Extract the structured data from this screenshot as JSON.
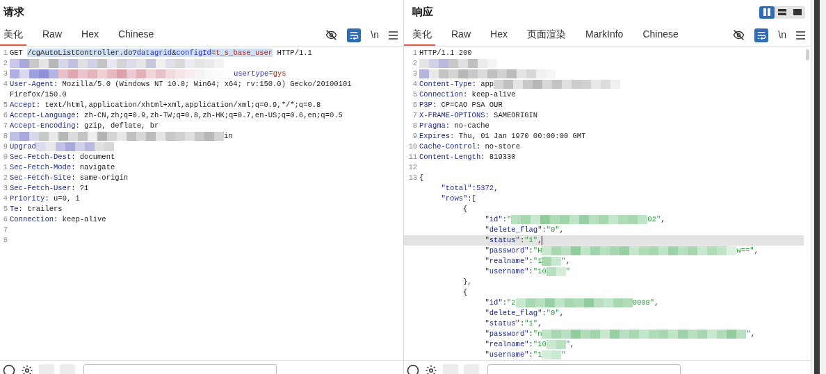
{
  "panes": [
    {
      "title": "请求",
      "tabs": [
        {
          "label": "美化",
          "selected": true
        },
        {
          "label": "Raw",
          "selected": false
        },
        {
          "label": "Hex",
          "selected": false
        },
        {
          "label": "Chinese",
          "selected": false
        }
      ],
      "toolbar": {
        "wrap_on": true,
        "newline_label": "\\n"
      },
      "lines": [
        {
          "num": "1",
          "segments": [
            {
              "kind": "plain",
              "text": "GET ",
              "selected": false
            },
            {
              "kind": "plain",
              "text": "/cgAutoListController.do?",
              "selected": true
            },
            {
              "kind": "param",
              "text": "datagrid",
              "selected": true
            },
            {
              "kind": "plain",
              "text": "&",
              "selected": true
            },
            {
              "kind": "param",
              "text": "configId",
              "selected": true
            },
            {
              "kind": "plain",
              "text": "=",
              "selected": true
            },
            {
              "kind": "pval",
              "text": "t_s_base_user",
              "selected": true
            },
            {
              "kind": "plain",
              "text": " HTTP/1.1",
              "selected": false
            }
          ]
        },
        {
          "num": "2",
          "segments": [
            {
              "kind": "redacted",
              "cells": [
                {
                  "color": "#c8c8e8"
                },
                {
                  "color": "#a8a8dc"
                },
                {
                  "color": "#c8c8c8"
                },
                {
                  "color": "#e4e4e4"
                },
                {
                  "color": "#b8b8b8"
                },
                {
                  "color": "#d8d8ec"
                },
                {
                  "color": "#c0c0e0"
                },
                {
                  "color": "#e0e0e0"
                },
                {
                  "color": "#d0d0e8"
                },
                {
                  "color": "#c4c4c4"
                },
                {
                  "color": "#e8e8f0"
                },
                {
                  "color": "#d4d4d4"
                },
                {
                  "color": "#dcdcec"
                },
                {
                  "color": "#e6e6e6"
                },
                {
                  "color": "#c8c8dc"
                },
                {
                  "color": "#f0f0f0"
                },
                {
                  "color": "#e0e0ec"
                },
                {
                  "color": "#dadada"
                },
                {
                  "color": "#ececf4"
                },
                {
                  "color": "#e4e4e4"
                },
                {
                  "color": "#eaeaea"
                },
                {
                  "color": "#f2f2f2"
                }
              ]
            }
          ]
        },
        {
          "num": "3",
          "segments": [
            {
              "kind": "redacted",
              "cells": [
                {
                  "color": "#b0b0e0"
                },
                {
                  "color": "#d8d8ee"
                },
                {
                  "color": "#a0a0dc"
                },
                {
                  "color": "#9090d8"
                },
                {
                  "color": "#b4b4e4"
                },
                {
                  "color": "#e8c0c8"
                },
                {
                  "color": "#e0a8b0"
                },
                {
                  "color": "#ecc4cc"
                },
                {
                  "color": "#e4b4bc"
                },
                {
                  "color": "#f0d0d4"
                },
                {
                  "color": "#e8b8c0"
                },
                {
                  "color": "#dca0a8"
                },
                {
                  "color": "#ecc8d0"
                },
                {
                  "color": "#e4b0b8"
                },
                {
                  "color": "#f0d4d8"
                },
                {
                  "color": "#e8c0c8"
                },
                {
                  "color": "#f2dadc"
                },
                {
                  "color": "#f6e4e6"
                },
                {
                  "color": "#f8ecee"
                },
                {
                  "color": "#f4f4f4"
                },
                {
                  "color": "#fafafa"
                },
                {
                  "color": "#fcfcfc"
                },
                {
                  "color": "#fefefe"
                }
              ]
            },
            {
              "kind": "param",
              "text": "usertype",
              "selected": false
            },
            {
              "kind": "plain",
              "text": "=",
              "selected": false
            },
            {
              "kind": "pval",
              "text": "gys",
              "selected": false
            }
          ]
        },
        {
          "num": "4",
          "segments": [
            {
              "kind": "name",
              "text": "User-Agent"
            },
            {
              "kind": "plain",
              "text": ": Mozilla/5.0 (Windows NT 10.0; Win64; x64; rv:150.0) Gecko/20100101",
              "selected": false
            }
          ]
        },
        {
          "segments": [
            {
              "kind": "plain",
              "text": "Firefox/150.0",
              "selected": false
            }
          ]
        },
        {
          "num": "5",
          "segments": [
            {
              "kind": "name",
              "text": "Accept"
            },
            {
              "kind": "plain",
              "text": ": text/html,application/xhtml+xml,application/xml;q=0.9,*/*;q=0.8",
              "selected": false
            }
          ]
        },
        {
          "num": "6",
          "segments": [
            {
              "kind": "name",
              "text": "Accept-Language"
            },
            {
              "kind": "plain",
              "text": ": zh-CN,zh;q=0.9,zh-TW;q=0.8,zh-HK;q=0.7,en-US;q=0.6,en;q=0.5",
              "selected": false
            }
          ]
        },
        {
          "num": "7",
          "segments": [
            {
              "kind": "name",
              "text": "Accept-Encoding"
            },
            {
              "kind": "plain",
              "text": ": gzip, deflate, br",
              "selected": false
            }
          ]
        },
        {
          "num": "8",
          "segments": [
            {
              "kind": "redacted",
              "cells": [
                {
                  "color": "#c0c0e4"
                },
                {
                  "color": "#a8a8dc"
                },
                {
                  "color": "#d8d8ec"
                },
                {
                  "color": "#c8c8c8"
                },
                {
                  "color": "#e8e8e8"
                },
                {
                  "color": "#b8b8b8"
                },
                {
                  "color": "#dcdcdc"
                },
                {
                  "color": "#c4c4c4"
                },
                {
                  "color": "#eeeeee"
                },
                {
                  "color": "#b4b4b4"
                },
                {
                  "color": "#d4d4d4"
                },
                {
                  "color": "#e8e8e8"
                },
                {
                  "color": "#c0c0c0"
                },
                {
                  "color": "#d8d8d8"
                },
                {
                  "color": "#bcbcbc"
                },
                {
                  "color": "#e4e4e4"
                },
                {
                  "color": "#c8c8c8"
                },
                {
                  "color": "#d0d0d0"
                },
                {
                  "color": "#e0e0e0"
                },
                {
                  "color": "#c8c8c8"
                },
                {
                  "color": "#b8b8b8"
                },
                {
                  "color": "#d4d4d4"
                }
              ]
            },
            {
              "kind": "plain",
              "text": "in",
              "selected": false
            }
          ]
        },
        {
          "num": "9",
          "segments": [
            {
              "kind": "name",
              "text": "Upgrad"
            },
            {
              "kind": "redacted",
              "cells": [
                {
                  "color": "#dcdcf0"
                },
                {
                  "color": "#e8e8e8"
                },
                {
                  "color": "#c0c0e4"
                },
                {
                  "color": "#a8a8dc"
                },
                {
                  "color": "#d0d0ec"
                },
                {
                  "color": "#b8b8e0"
                },
                {
                  "color": "#e0e0e0"
                },
                {
                  "color": "#d8d8d8"
                }
              ]
            }
          ]
        },
        {
          "num": "0",
          "segments": [
            {
              "kind": "name",
              "text": "Sec-Fetch-Dest"
            },
            {
              "kind": "plain",
              "text": ": document",
              "selected": false
            }
          ]
        },
        {
          "num": "1",
          "segments": [
            {
              "kind": "name",
              "text": "Sec-Fetch-Mode"
            },
            {
              "kind": "plain",
              "text": ": navigate",
              "selected": false
            }
          ]
        },
        {
          "num": "2",
          "segments": [
            {
              "kind": "name",
              "text": "Sec-Fetch-Site"
            },
            {
              "kind": "plain",
              "text": ": same-origin",
              "selected": false
            }
          ]
        },
        {
          "num": "3",
          "segments": [
            {
              "kind": "name",
              "text": "Sec-Fetch-User"
            },
            {
              "kind": "plain",
              "text": ": ?1",
              "selected": false
            }
          ]
        },
        {
          "num": "4",
          "segments": [
            {
              "kind": "name",
              "text": "Priority"
            },
            {
              "kind": "plain",
              "text": ": u=0, i",
              "selected": false
            }
          ]
        },
        {
          "num": "5",
          "segments": [
            {
              "kind": "name",
              "text": "Te"
            },
            {
              "kind": "plain",
              "text": ": trailers",
              "selected": false
            }
          ]
        },
        {
          "num": "6",
          "segments": [
            {
              "kind": "name",
              "text": "Connection"
            },
            {
              "kind": "plain",
              "text": ": keep-alive",
              "selected": false
            }
          ]
        },
        {
          "num": "7"
        },
        {
          "num": "8"
        }
      ]
    },
    {
      "title": "响应",
      "tabs": [
        {
          "label": "美化",
          "selected": true
        },
        {
          "label": "Raw",
          "selected": false
        },
        {
          "label": "Hex",
          "selected": false
        },
        {
          "label": "页面渲染",
          "selected": false
        },
        {
          "label": "MarkInfo",
          "selected": false
        },
        {
          "label": "Chinese",
          "selected": false
        }
      ],
      "layout_modes": [
        {
          "kind": "split",
          "selected": true
        },
        {
          "kind": "stacked",
          "selected": false
        },
        {
          "kind": "single",
          "selected": false
        }
      ],
      "toolbar": {
        "wrap_on": true,
        "newline_label": "\\n"
      },
      "lines": [
        {
          "num": "1",
          "current": false,
          "segments": [
            {
              "kind": "plain",
              "text": "HTTP/1.1 200",
              "selected": false
            }
          ]
        },
        {
          "num": "2",
          "current": false,
          "segments": [
            {
              "kind": "redacted",
              "cells": [
                {
                  "color": "#e4e4e4"
                },
                {
                  "color": "#d0d0e8"
                },
                {
                  "color": "#b8b8e0"
                },
                {
                  "color": "#c8c8c8"
                },
                {
                  "color": "#e0e0e0"
                },
                {
                  "color": "#c0c0c0"
                },
                {
                  "color": "#ececec"
                },
                {
                  "color": "#f4f4f4"
                }
              ]
            }
          ]
        },
        {
          "num": "3",
          "current": false,
          "segments": [
            {
              "kind": "redacted",
              "cells": [
                {
                  "color": "#b4b4dc"
                },
                {
                  "color": "#e8e8e8"
                },
                {
                  "color": "#c4c4c4"
                },
                {
                  "color": "#d4d4d4"
                },
                {
                  "color": "#b8b8b8"
                },
                {
                  "color": "#c8c8c8"
                },
                {
                  "color": "#dcdcdc"
                },
                {
                  "color": "#c0c0c0"
                },
                {
                  "color": "#d0d0d0"
                },
                {
                  "color": "#bcbcbc"
                },
                {
                  "color": "#e4e4e4"
                },
                {
                  "color": "#d8d8d8"
                },
                {
                  "color": "#f0f0f0"
                },
                {
                  "color": "#f6f6f6"
                }
              ]
            }
          ]
        },
        {
          "num": "4",
          "current": false,
          "segments": [
            {
              "kind": "name",
              "text": "Content-Type"
            },
            {
              "kind": "plain",
              "text": ": app",
              "selected": false
            },
            {
              "kind": "redacted",
              "cells": [
                {
                  "color": "#d4d4d4"
                },
                {
                  "color": "#c0c0c0"
                },
                {
                  "color": "#e4e4e4"
                },
                {
                  "color": "#c8c8c8"
                },
                {
                  "color": "#b8b8b8"
                },
                {
                  "color": "#d8d8d8"
                },
                {
                  "color": "#c4c4c4"
                },
                {
                  "color": "#e0e0e0"
                },
                {
                  "color": "#cccccc"
                },
                {
                  "color": "#d0d0d0"
                },
                {
                  "color": "#e8e8e8"
                },
                {
                  "color": "#dcdcdc"
                },
                {
                  "color": "#f0f0f0"
                }
              ]
            }
          ]
        },
        {
          "num": "5",
          "current": false,
          "segments": [
            {
              "kind": "name",
              "text": "Connection"
            },
            {
              "kind": "plain",
              "text": ": keep-alive",
              "selected": false
            }
          ]
        },
        {
          "num": "6",
          "current": false,
          "segments": [
            {
              "kind": "name",
              "text": "P3P"
            },
            {
              "kind": "plain",
              "text": ": CP=CAO PSA OUR",
              "selected": false
            }
          ]
        },
        {
          "num": "7",
          "current": false,
          "segments": [
            {
              "kind": "name",
              "text": "X-FRAME-OPTIONS"
            },
            {
              "kind": "plain",
              "text": ": SAMEORIGIN",
              "selected": false
            }
          ]
        },
        {
          "num": "8",
          "current": false,
          "segments": [
            {
              "kind": "name",
              "text": "Pragma"
            },
            {
              "kind": "plain",
              "text": ": no-cache",
              "selected": false
            }
          ]
        },
        {
          "num": "9",
          "current": false,
          "segments": [
            {
              "kind": "name",
              "text": "Expires"
            },
            {
              "kind": "plain",
              "text": ": Thu, 01 Jan 1970 00:00:00 GMT",
              "selected": false
            }
          ]
        },
        {
          "num": "10",
          "current": false,
          "segments": [
            {
              "kind": "name",
              "text": "Cache-Control"
            },
            {
              "kind": "plain",
              "text": ": no-store",
              "selected": false
            }
          ]
        },
        {
          "num": "11",
          "current": false,
          "segments": [
            {
              "kind": "name",
              "text": "Content-Length"
            },
            {
              "kind": "plain",
              "text": ": 819330",
              "selected": false
            }
          ]
        },
        {
          "num": "12",
          "current": false
        },
        {
          "num": "13",
          "current": false,
          "segments": [
            {
              "kind": "plain",
              "text": "{",
              "selected": false
            }
          ]
        },
        {
          "current": false,
          "segments": [
            {
              "kind": "jkey",
              "text": "     \"total\""
            },
            {
              "kind": "plain",
              "text": ":",
              "selected": false
            },
            {
              "kind": "jnum",
              "text": "5372"
            },
            {
              "kind": "plain",
              "text": ",",
              "selected": false
            }
          ]
        },
        {
          "current": false,
          "segments": [
            {
              "kind": "jkey",
              "text": "     \"rows\""
            },
            {
              "kind": "plain",
              "text": ":[",
              "selected": false
            }
          ]
        },
        {
          "current": false,
          "segments": [
            {
              "kind": "plain",
              "text": "          {",
              "selected": false
            }
          ]
        },
        {
          "current": false,
          "segments": [
            {
              "kind": "jkey",
              "text": "               \"id\""
            },
            {
              "kind": "plain",
              "text": ":",
              "selected": false
            },
            {
              "kind": "jstr",
              "text": "\""
            },
            {
              "kind": "redacted",
              "cells": [
                {
                  "color": "#b8e0c0"
                },
                {
                  "color": "#a8d8b0"
                },
                {
                  "color": "#c8e8d0"
                },
                {
                  "color": "#90cc9c"
                },
                {
                  "color": "#b0dcb8"
                },
                {
                  "color": "#a0d4ac"
                },
                {
                  "color": "#c0e4c8"
                },
                {
                  "color": "#98d0a4"
                },
                {
                  "color": "#b8e0c0"
                },
                {
                  "color": "#a8d8b0"
                },
                {
                  "color": "#c4e6cc"
                },
                {
                  "color": "#b0dcb8"
                },
                {
                  "color": "#a8d8b0"
                },
                {
                  "color": "#c0e4c8"
                }
              ]
            },
            {
              "kind": "jstr",
              "text": "02\""
            },
            {
              "kind": "plain",
              "text": ",",
              "selected": false
            }
          ]
        },
        {
          "current": false,
          "segments": [
            {
              "kind": "jkey",
              "text": "               \"delete_flag\""
            },
            {
              "kind": "plain",
              "text": ":",
              "selected": false
            },
            {
              "kind": "jstr",
              "text": "\"0\""
            },
            {
              "kind": "plain",
              "text": ",",
              "selected": false
            }
          ]
        },
        {
          "current": true,
          "segments": [
            {
              "kind": "jkey",
              "text": "               \"status\""
            },
            {
              "kind": "plain",
              "text": ":",
              "selected": false
            },
            {
              "kind": "jstr",
              "text": "\"1\""
            },
            {
              "kind": "plain",
              "text": ",",
              "selected": false
            }
          ]
        },
        {
          "current": false,
          "segments": [
            {
              "kind": "jkey",
              "text": "               \"password\""
            },
            {
              "kind": "plain",
              "text": ":",
              "selected": false
            },
            {
              "kind": "jstr",
              "text": "\"H"
            },
            {
              "kind": "redacted",
              "cells": [
                {
                  "color": "#c8e8d0"
                },
                {
                  "color": "#a8d8b0"
                },
                {
                  "color": "#b8e0c0"
                },
                {
                  "color": "#90cc9c"
                },
                {
                  "color": "#c0e4c8"
                },
                {
                  "color": "#a0d4ac"
                },
                {
                  "color": "#b8e0c0"
                },
                {
                  "color": "#a8d8b0"
                },
                {
                  "color": "#98d0a4"
                },
                {
                  "color": "#c4e6cc"
                },
                {
                  "color": "#b0dcb8"
                },
                {
                  "color": "#a8d8b0"
                },
                {
                  "color": "#c0e4c8"
                },
                {
                  "color": "#9cd2a8"
                },
                {
                  "color": "#b8e0c0"
                },
                {
                  "color": "#a8d8b0"
                },
                {
                  "color": "#c8e8d0"
                },
                {
                  "color": "#b0dcb8"
                },
                {
                  "color": "#c0e4c8"
                },
                {
                  "color": "#dcf0e0"
                }
              ]
            },
            {
              "kind": "jstr",
              "text": "w==\""
            },
            {
              "kind": "plain",
              "text": ",",
              "selected": false
            }
          ]
        },
        {
          "current": false,
          "segments": [
            {
              "kind": "jkey",
              "text": "               \"realname\""
            },
            {
              "kind": "plain",
              "text": ":",
              "selected": false
            },
            {
              "kind": "jstr",
              "text": "\"1"
            },
            {
              "kind": "redacted",
              "cells": [
                {
                  "color": "#a8d8b0"
                },
                {
                  "color": "#c8e8d0"
                }
              ]
            },
            {
              "kind": "jstr",
              "text": "\""
            },
            {
              "kind": "plain",
              "text": ",",
              "selected": false
            }
          ]
        },
        {
          "current": false,
          "segments": [
            {
              "kind": "jkey",
              "text": "               \"username\""
            },
            {
              "kind": "plain",
              "text": ":",
              "selected": false
            },
            {
              "kind": "jstr",
              "text": "\"10"
            },
            {
              "kind": "redacted",
              "cells": [
                {
                  "color": "#b8e0c0"
                },
                {
                  "color": "#d4eed8"
                }
              ]
            },
            {
              "kind": "jstr",
              "text": "\""
            }
          ]
        },
        {
          "current": false,
          "segments": [
            {
              "kind": "plain",
              "text": "          },",
              "selected": false
            }
          ]
        },
        {
          "current": false,
          "segments": [
            {
              "kind": "plain",
              "text": "          {",
              "selected": false
            }
          ]
        },
        {
          "current": false,
          "segments": [
            {
              "kind": "jkey",
              "text": "               \"id\""
            },
            {
              "kind": "plain",
              "text": ":",
              "selected": false
            },
            {
              "kind": "jstr",
              "text": "\"2"
            },
            {
              "kind": "redacted",
              "cells": [
                {
                  "color": "#c8e8d0"
                },
                {
                  "color": "#a8d8b0"
                },
                {
                  "color": "#b8e0c0"
                },
                {
                  "color": "#98d0a4"
                },
                {
                  "color": "#c0e4c8"
                },
                {
                  "color": "#a8d8b0"
                },
                {
                  "color": "#b0dcb8"
                },
                {
                  "color": "#90cc9c"
                },
                {
                  "color": "#b8e0c0"
                },
                {
                  "color": "#c4e6cc"
                },
                {
                  "color": "#a8d8b0"
                },
                {
                  "color": "#b0dcb8"
                }
              ]
            },
            {
              "kind": "jstr",
              "text": "0008\""
            },
            {
              "kind": "plain",
              "text": ",",
              "selected": false
            }
          ]
        },
        {
          "current": false,
          "segments": [
            {
              "kind": "jkey",
              "text": "               \"delete_flag\""
            },
            {
              "kind": "plain",
              "text": ":",
              "selected": false
            },
            {
              "kind": "jstr",
              "text": "\"0\""
            },
            {
              "kind": "plain",
              "text": ",",
              "selected": false
            }
          ]
        },
        {
          "current": false,
          "segments": [
            {
              "kind": "jkey",
              "text": "               \"status\""
            },
            {
              "kind": "plain",
              "text": ":",
              "selected": false
            },
            {
              "kind": "jstr",
              "text": "\"1\""
            },
            {
              "kind": "plain",
              "text": ",",
              "selected": false
            }
          ]
        },
        {
          "current": false,
          "segments": [
            {
              "kind": "jkey",
              "text": "               \"password\""
            },
            {
              "kind": "plain",
              "text": ":",
              "selected": false
            },
            {
              "kind": "jstr",
              "text": "\"n"
            },
            {
              "kind": "redacted",
              "cells": [
                {
                  "color": "#c0e4c8"
                },
                {
                  "color": "#a8d8b0"
                },
                {
                  "color": "#b8e0c0"
                },
                {
                  "color": "#90cc9c"
                },
                {
                  "color": "#b0dcb8"
                },
                {
                  "color": "#a0d4ac"
                },
                {
                  "color": "#c8e8d0"
                },
                {
                  "color": "#98d0a4"
                },
                {
                  "color": "#b8e0c0"
                },
                {
                  "color": "#a8d8b0"
                },
                {
                  "color": "#c4e6cc"
                },
                {
                  "color": "#b0dcb8"
                },
                {
                  "color": "#a8d8b0"
                },
                {
                  "color": "#c0e4c8"
                },
                {
                  "color": "#9cd2a8"
                },
                {
                  "color": "#b8e0c0"
                },
                {
                  "color": "#a8d8b0"
                },
                {
                  "color": "#c8e8d0"
                },
                {
                  "color": "#b0dcb8"
                },
                {
                  "color": "#90cc9c"
                },
                {
                  "color": "#b8e0c0"
                }
              ]
            },
            {
              "kind": "jstr",
              "text": "\""
            },
            {
              "kind": "plain",
              "text": ",",
              "selected": false
            }
          ]
        },
        {
          "current": false,
          "segments": [
            {
              "kind": "jkey",
              "text": "               \"realname\""
            },
            {
              "kind": "plain",
              "text": ":",
              "selected": false
            },
            {
              "kind": "jstr",
              "text": "\"10"
            },
            {
              "kind": "redacted",
              "cells": [
                {
                  "color": "#c8e8d0"
                },
                {
                  "color": "#b8e0c0"
                }
              ]
            },
            {
              "kind": "jstr",
              "text": "\""
            },
            {
              "kind": "plain",
              "text": ",",
              "selected": false
            }
          ]
        },
        {
          "current": false,
          "segments": [
            {
              "kind": "jkey",
              "text": "               \"username\""
            },
            {
              "kind": "plain",
              "text": ":",
              "selected": false
            },
            {
              "kind": "jstr",
              "text": "\"1"
            },
            {
              "kind": "redacted",
              "cells": [
                {
                  "color": "#d4eed8"
                },
                {
                  "color": "#c8e8d0"
                }
              ]
            },
            {
              "kind": "jstr",
              "text": "\""
            }
          ]
        }
      ]
    }
  ]
}
